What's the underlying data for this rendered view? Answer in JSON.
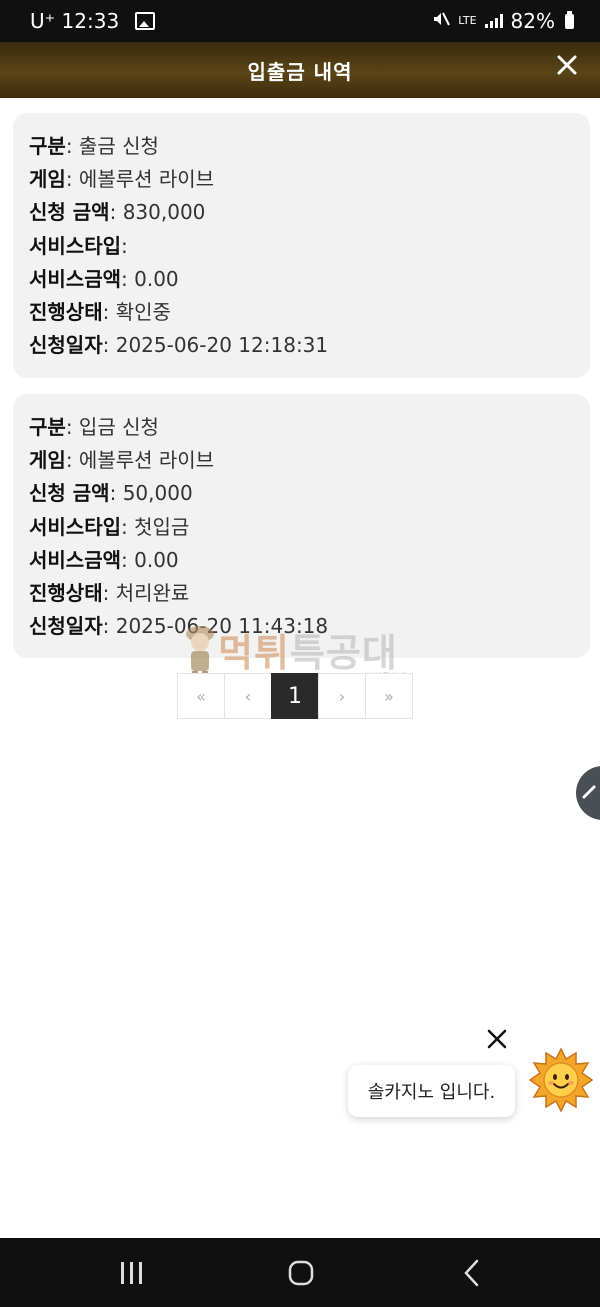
{
  "status_bar": {
    "carrier_time": "U⁺ 12:33",
    "network": "LTE",
    "battery": "82%"
  },
  "header": {
    "title": "입출금 내역"
  },
  "records": [
    {
      "type_label": "구분",
      "type": "출금 신청",
      "game_label": "게임",
      "game": "에볼루션 라이브",
      "amount_label": "신청 금액",
      "amount": "830,000",
      "service_type_label": "서비스타입",
      "service_type": "",
      "service_amount_label": "서비스금액",
      "service_amount": "0.00",
      "status_label": "진행상태",
      "status": "확인중",
      "date_label": "신청일자",
      "date": "2025-06-20 12:18:31"
    },
    {
      "type_label": "구분",
      "type": "입금 신청",
      "game_label": "게임",
      "game": "에볼루션 라이브",
      "amount_label": "신청 금액",
      "amount": "50,000",
      "service_type_label": "서비스타입",
      "service_type": "첫입금",
      "service_amount_label": "서비스금액",
      "service_amount": "0.00",
      "status_label": "진행상태",
      "status": "처리완료",
      "date_label": "신청일자",
      "date": "2025-06-20 11:43:18"
    }
  ],
  "pagination": {
    "first": "«",
    "prev": "‹",
    "current": "1",
    "next": "›",
    "last": "»"
  },
  "watermark": {
    "main": "먹튀",
    "accent": "특공대",
    "small": "먹튀특공대"
  },
  "chat": {
    "message": "솔카지노 입니다."
  },
  "colors": {
    "header_brown": "#5b4516",
    "card_bg": "#f2f2f2",
    "active_page": "#2a2a2a"
  },
  "icons": [
    "gallery-icon",
    "mute-icon",
    "signal-icon",
    "battery-icon",
    "close-icon",
    "chevron-up-icon",
    "sun-avatar-icon",
    "recent-apps-icon",
    "home-icon",
    "back-icon"
  ]
}
